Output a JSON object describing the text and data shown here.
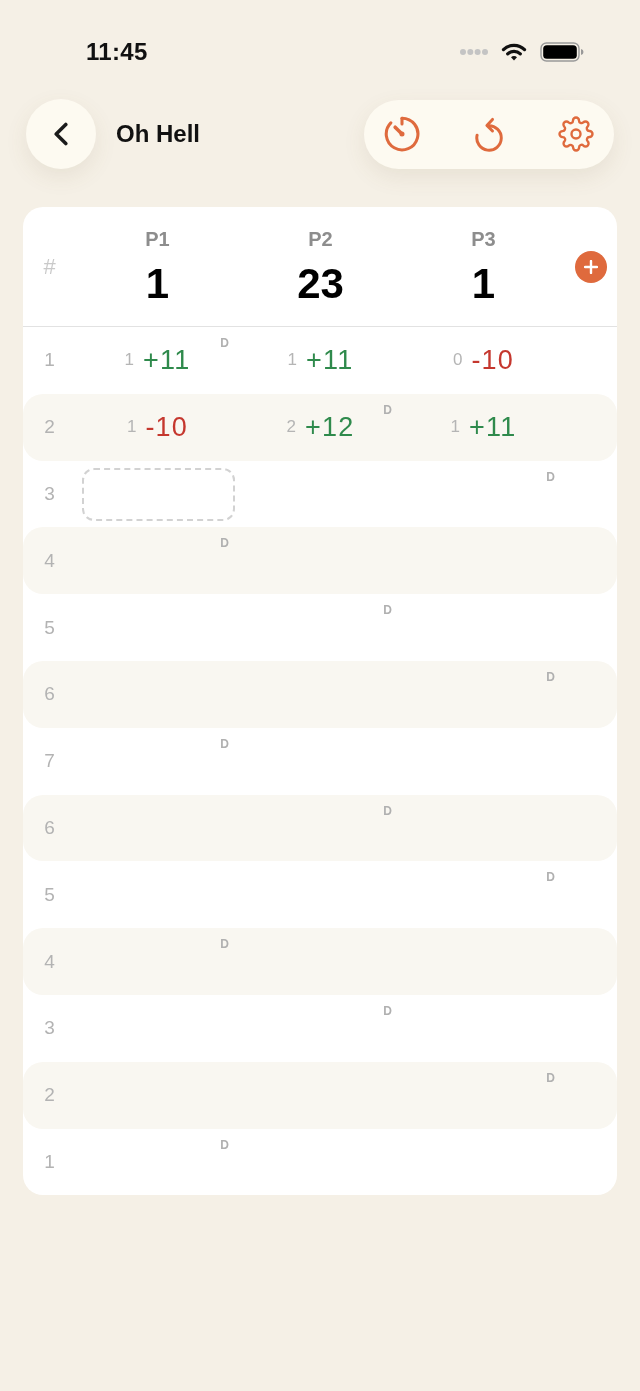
{
  "status_bar": {
    "time": "11:45"
  },
  "nav": {
    "title": "Oh Hell"
  },
  "scoreboard": {
    "round_header": "#",
    "players": [
      {
        "name": "P1",
        "total": "1"
      },
      {
        "name": "P2",
        "total": "23"
      },
      {
        "name": "P3",
        "total": "1"
      }
    ],
    "rounds": [
      {
        "number": "1",
        "cells": [
          {
            "kind": "score",
            "bid": "1",
            "score": "+11",
            "made": true,
            "dealer_badge": "D"
          },
          {
            "kind": "score",
            "bid": "1",
            "score": "+11",
            "made": true
          },
          {
            "kind": "score",
            "bid": "0",
            "score": "-10",
            "made": false
          }
        ]
      },
      {
        "number": "2",
        "cells": [
          {
            "kind": "score",
            "bid": "1",
            "score": "-10",
            "made": false
          },
          {
            "kind": "score",
            "bid": "2",
            "score": "+12",
            "made": true,
            "dealer_badge": "D"
          },
          {
            "kind": "score",
            "bid": "1",
            "score": "+11",
            "made": true
          }
        ]
      },
      {
        "number": "3",
        "cells": [
          {
            "kind": "input"
          },
          {
            "kind": "blank"
          },
          {
            "kind": "blank",
            "dealer_badge": "D"
          }
        ]
      },
      {
        "number": "4",
        "cells": [
          {
            "kind": "blank",
            "dealer_badge": "D"
          },
          {
            "kind": "blank"
          },
          {
            "kind": "blank"
          }
        ]
      },
      {
        "number": "5",
        "cells": [
          {
            "kind": "blank"
          },
          {
            "kind": "blank",
            "dealer_badge": "D"
          },
          {
            "kind": "blank"
          }
        ]
      },
      {
        "number": "6",
        "cells": [
          {
            "kind": "blank"
          },
          {
            "kind": "blank"
          },
          {
            "kind": "blank",
            "dealer_badge": "D"
          }
        ]
      },
      {
        "number": "7",
        "cells": [
          {
            "kind": "blank",
            "dealer_badge": "D"
          },
          {
            "kind": "blank"
          },
          {
            "kind": "blank"
          }
        ]
      },
      {
        "number": "6",
        "cells": [
          {
            "kind": "blank"
          },
          {
            "kind": "blank",
            "dealer_badge": "D"
          },
          {
            "kind": "blank"
          }
        ]
      },
      {
        "number": "5",
        "cells": [
          {
            "kind": "blank"
          },
          {
            "kind": "blank"
          },
          {
            "kind": "blank",
            "dealer_badge": "D"
          }
        ]
      },
      {
        "number": "4",
        "cells": [
          {
            "kind": "blank",
            "dealer_badge": "D"
          },
          {
            "kind": "blank"
          },
          {
            "kind": "blank"
          }
        ]
      },
      {
        "number": "3",
        "cells": [
          {
            "kind": "blank"
          },
          {
            "kind": "blank",
            "dealer_badge": "D"
          },
          {
            "kind": "blank"
          }
        ]
      },
      {
        "number": "2",
        "cells": [
          {
            "kind": "blank"
          },
          {
            "kind": "blank"
          },
          {
            "kind": "blank",
            "dealer_badge": "D"
          }
        ]
      },
      {
        "number": "1",
        "cells": [
          {
            "kind": "blank",
            "dealer_badge": "D"
          },
          {
            "kind": "blank"
          },
          {
            "kind": "blank"
          }
        ]
      }
    ]
  }
}
